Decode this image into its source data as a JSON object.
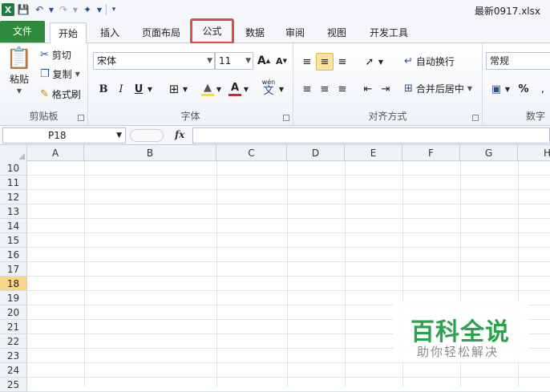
{
  "window": {
    "title": "最新0917.xlsx"
  },
  "qat": {
    "excel_icon": "X"
  },
  "tabs": [
    {
      "label": "文件"
    },
    {
      "label": "开始"
    },
    {
      "label": "插入"
    },
    {
      "label": "页面布局"
    },
    {
      "label": "公式"
    },
    {
      "label": "数据"
    },
    {
      "label": "审阅"
    },
    {
      "label": "视图"
    },
    {
      "label": "开发工具"
    }
  ],
  "clipboard": {
    "paste": "粘贴",
    "cut": "剪切",
    "copy": "复制",
    "format_painter": "格式刷",
    "group_label": "剪贴板"
  },
  "font": {
    "name": "宋体",
    "size": "11",
    "group_label": "字体",
    "bold": "B",
    "italic": "I",
    "underline": "U",
    "grow": "A",
    "shrink": "A",
    "font_color": "A",
    "wen": "wén"
  },
  "alignment": {
    "wrap_text": "自动换行",
    "merge_center": "合并后居中",
    "group_label": "对齐方式"
  },
  "number": {
    "format": "常规",
    "percent": "%",
    "group_label": "数字"
  },
  "formula_bar": {
    "name_box": "P18",
    "fx": "fx",
    "value": ""
  },
  "columns": [
    "A",
    "B",
    "C",
    "D",
    "E",
    "F",
    "G",
    "H"
  ],
  "rows": [
    "10",
    "11",
    "12",
    "13",
    "14",
    "15",
    "16",
    "17",
    "18",
    "19",
    "20",
    "21",
    "22",
    "23",
    "24",
    "25"
  ],
  "active_row": "18",
  "watermark": {
    "title": "百科全说",
    "subtitle": "助你轻松解决"
  },
  "colors": {
    "file_tab": "#2f8a3e",
    "highlight": "#e04b4b",
    "watermark": "#2aa34a",
    "active_row_header": "#f7d783"
  }
}
